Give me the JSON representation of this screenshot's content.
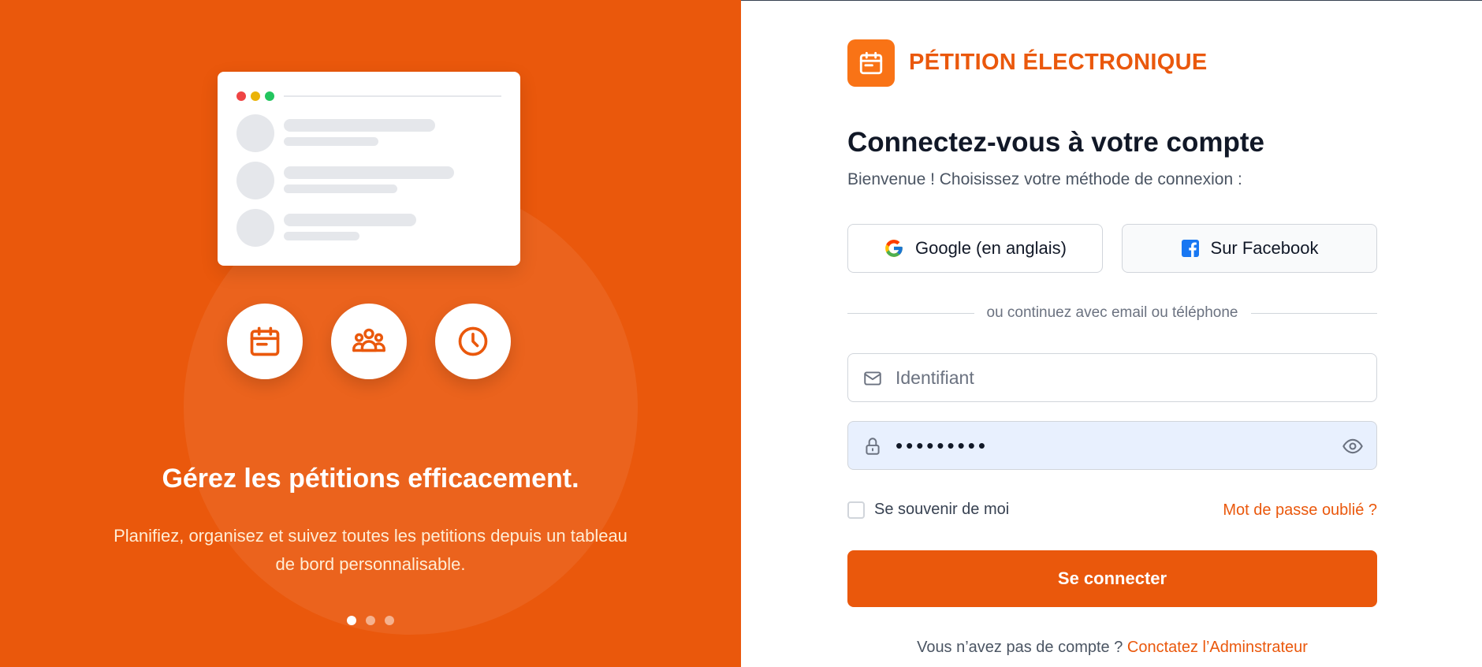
{
  "colors": {
    "brand": "#ea580c",
    "brand_light": "#f97316",
    "text_dark": "#111827",
    "text_muted": "#4b5563",
    "autofill_bg": "#e8f0fe"
  },
  "hero": {
    "title": "Gérez les pétitions efficacement.",
    "description": "Planifiez, organisez et suivez toutes les petitions depuis un tableau de bord personnalisable.",
    "feature_icons": [
      "calendar-icon",
      "users-icon",
      "clock-icon"
    ],
    "slides": {
      "count": 3,
      "active": 1
    }
  },
  "brand": {
    "name": "PÉTITION ÉLECTRONIQUE",
    "logo_icon": "calendar-icon"
  },
  "login": {
    "title": "Connectez-vous à votre compte",
    "subtitle": "Bienvenue ! Choisissez votre méthode de connexion :",
    "google_label": "Google (en anglais)",
    "facebook_label": "Sur Facebook",
    "divider_text": "ou continuez avec email ou téléphone",
    "username_placeholder": "Identifiant",
    "username_value": "",
    "password_value": "•••••••••",
    "remember_label": "Se souvenir de moi",
    "remember_checked": false,
    "forgot_label": "Mot de passe oublié ?",
    "submit_label": "Se connecter",
    "signup_text": "Vous n’avez pas de compte ?",
    "signup_link": "Conctatez l’Adminstrateur"
  }
}
